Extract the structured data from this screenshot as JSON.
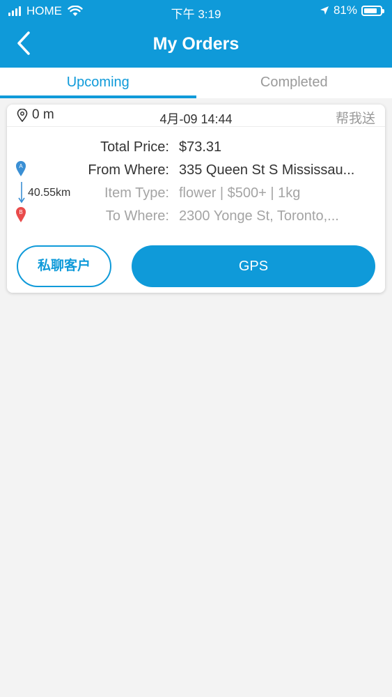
{
  "status_bar": {
    "carrier": "HOME",
    "time": "下午 3:19",
    "battery": "81%",
    "battery_level": 0.81,
    "icons": [
      "signal-icon",
      "wifi-icon",
      "location-arrow-icon",
      "battery-icon"
    ]
  },
  "nav": {
    "title": "My Orders",
    "back_icon": "chevron-left-icon"
  },
  "tabs": [
    {
      "label": "Upcoming",
      "active": true
    },
    {
      "label": "Completed",
      "active": false
    }
  ],
  "order": {
    "distance": "0 m",
    "datetime": "4月-09 14:44",
    "service_tag": "帮我送",
    "route_distance": "40.55km",
    "pins": {
      "start": "A",
      "end": "B"
    },
    "rows": [
      {
        "label": "Total Price:",
        "value": "$73.31"
      },
      {
        "label": "From Where:",
        "value": "335 Queen St S Mississau..."
      },
      {
        "label": "Item Type:",
        "value": "flower | $500+ | 1kg"
      },
      {
        "label": "To Where:",
        "value": "2300 Yonge St, Toronto,..."
      }
    ],
    "chat_button": "私聊客户",
    "gps_button": "GPS"
  },
  "colors": {
    "primary": "#0f9ad9",
    "pin_a": "#3a8fd4",
    "pin_b": "#e94b4b",
    "background": "#f3f3f3"
  }
}
